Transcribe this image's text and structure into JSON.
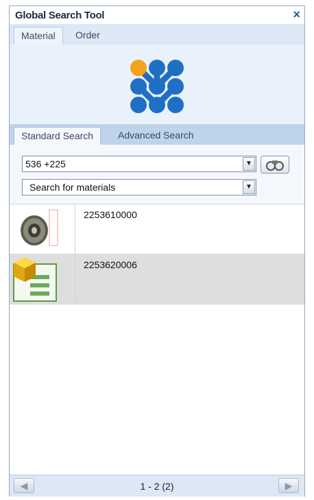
{
  "window": {
    "title": "Global Search Tool",
    "close_label": "×"
  },
  "top_tabs": [
    {
      "label": "Material",
      "active": true
    },
    {
      "label": "Order",
      "active": false
    }
  ],
  "logo": {
    "colors": {
      "orange": "#f5a21b",
      "blue": "#1f6fc5"
    }
  },
  "search_tabs": [
    {
      "label": "Standard Search",
      "active": true
    },
    {
      "label": "Advanced Search",
      "active": false
    }
  ],
  "search": {
    "query_value": "536 +225",
    "scope_value": "Search for materials",
    "go_icon": "binoculars-icon"
  },
  "results": [
    {
      "id": "2253610000",
      "icon": "gear-icon",
      "selected": false
    },
    {
      "id": "2253620006",
      "icon": "material-document-icon",
      "selected": true
    }
  ],
  "footer": {
    "pager": "1 - 2 (2)",
    "prev_icon": "arrow-left-icon",
    "next_icon": "arrow-right-icon"
  },
  "colors": {
    "accent": "#2a5aa8",
    "selection": "#dedede",
    "tab_bar": "#bfd4ea"
  }
}
